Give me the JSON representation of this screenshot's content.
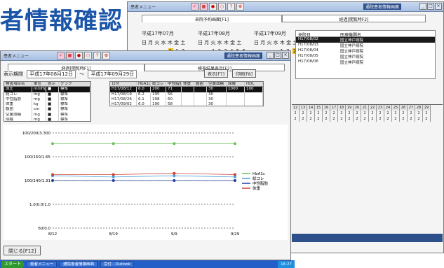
{
  "headline": "者情報確認",
  "back_window": {
    "title": "患者メニュー",
    "tray_title": "通院患者情報画面",
    "tabs": [
      "来院予約画面[F1]",
      "経過[閲覧時F2]"
    ],
    "calendars": [
      {
        "month": "平成17年07月",
        "weekdays": "日 月 火 水 木 金 土",
        "days": "1 2",
        "highlight": "1"
      },
      {
        "month": "平成17年08月",
        "weekdays": "日 月 火 水 木 金 土",
        "days": "1 2 3 4 5 6",
        "highlight": ""
      },
      {
        "month": "平成17年09月",
        "weekdays": "日 月 火 水 木 金 土",
        "days": "1 2",
        "highlight": "2"
      }
    ],
    "list": {
      "headers": [
        "来院日",
        "医療機関名"
      ],
      "rows": [
        {
          "date": "H17/08/02",
          "name": "国立神戸病院"
        },
        {
          "date": "H17/08/03",
          "name": "国立神戸病院"
        },
        {
          "date": "H17/08/04",
          "name": "国立神戸病院"
        },
        {
          "date": "H17/08/05",
          "name": "国立神戸病院"
        },
        {
          "date": "H17/08/06",
          "name": "国立神戸病院"
        }
      ]
    },
    "grid_header": [
      "12",
      "13",
      "14",
      "15",
      "16",
      "17",
      "18",
      "19",
      "20",
      "21",
      "22",
      "23",
      "24",
      "25",
      "26",
      "27",
      "28",
      "29"
    ],
    "grid_rows": [
      [
        "2",
        "2",
        "2",
        "2",
        "2",
        "2",
        "2",
        "2",
        "2",
        "2",
        "2",
        "2",
        "2",
        "2",
        "2",
        "2",
        "2",
        "2"
      ],
      [
        "2",
        "2",
        "2",
        "2",
        "2",
        "2",
        "2",
        "2",
        "2",
        "2",
        "2",
        "2",
        "2",
        "2",
        "2",
        "2",
        "2",
        "2"
      ]
    ]
  },
  "front_window": {
    "title": "患者メニュー",
    "tray_title": "通院患者情報画面",
    "tabs": [
      "経過[閲覧時F1]",
      "検査結果表示[F2]"
    ],
    "period_label": "表示期間",
    "date_from": "平成17年08月12日",
    "tilde": "～",
    "date_to": "平成17年09月29日",
    "btn_display": "表示[F7]",
    "btn_print": "印刷[F8]",
    "test_table": {
      "headers": [
        "検査項目名",
        "単位",
        "表示",
        "グラフ"
      ],
      "rows": [
        [
          "血圧",
          "mmHg",
          "■",
          "標準"
        ],
        [
          "総コレ",
          "mg",
          "■",
          "標準"
        ],
        [
          "中性脂肪",
          "mg",
          "■",
          "標準"
        ],
        [
          "体重",
          "kg",
          "■",
          "標準"
        ],
        [
          "腹囲",
          "cm",
          "■",
          "標準"
        ],
        [
          "空腹血糖",
          "mg",
          "■",
          "標準"
        ],
        [
          "尿酸",
          "mg",
          "■",
          "標準"
        ]
      ]
    },
    "result_table": {
      "headers": [
        "日付",
        "HbA1c",
        "総コレ",
        "中性脂肪",
        "体重",
        "腹囲",
        "空腹血糖",
        "尿酸",
        "HDL"
      ],
      "rows": [
        [
          "H17/08/12",
          "6.0",
          "200",
          "71",
          "",
          "",
          "30",
          "1000",
          "100"
        ],
        [
          "H17/08/19",
          "6.2",
          "195",
          "56",
          "",
          "",
          "30",
          "",
          ""
        ],
        [
          "H17/08/26",
          "6.1",
          "198",
          "60",
          "",
          "",
          "30",
          "",
          ""
        ],
        [
          "H17/09/02",
          "6.0",
          "190",
          "58",
          "",
          "",
          "30",
          "",
          ""
        ]
      ]
    },
    "bottom_button": "閉じる[F12]"
  },
  "taskbar": {
    "start": "スタート",
    "tasks": [
      "患者メニュー",
      "通院患者情報画面",
      "受付 - Outlook"
    ],
    "tray": "16:27"
  },
  "chart_data": {
    "type": "line",
    "categories": [
      "8/12",
      "8/19",
      "9/9",
      "9/29"
    ],
    "y_tick_labels": [
      "100/200/3.300",
      "100/150/1.65",
      "100/140/1.31",
      "1.0/0.0/1.0",
      "60/0.0"
    ],
    "ylim": [
      0,
      4
    ],
    "series": [
      {
        "name": "HbA1c",
        "values": [
          3.55,
          3.55,
          3.55,
          3.55
        ],
        "color": "#6fc05a"
      },
      {
        "name": "総コレ",
        "values": [
          2.2,
          2.15,
          2.2,
          2.15
        ],
        "color": "#4aa0d8"
      },
      {
        "name": "中性脂肪",
        "values": [
          2.0,
          2.0,
          2.0,
          2.0
        ],
        "color": "#1f3f9f"
      },
      {
        "name": "体重",
        "values": [
          2.25,
          2.25,
          2.3,
          2.25
        ],
        "color": "#d04030"
      }
    ]
  }
}
